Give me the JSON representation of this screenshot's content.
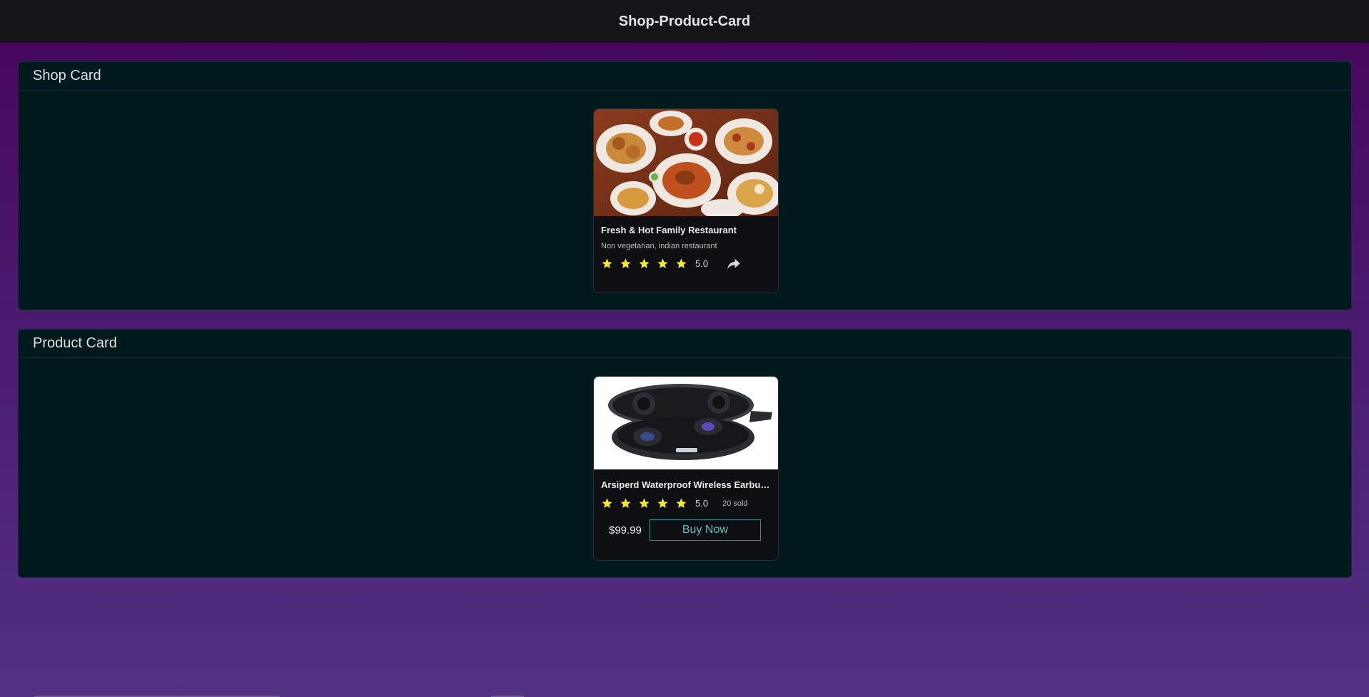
{
  "header": {
    "title": "Shop-Product-Card"
  },
  "shop_panel": {
    "title": "Shop Card",
    "card": {
      "image": "food-platter-image",
      "name": "Fresh & Hot Family Restaurant",
      "subtitle": "Non vegetarian, indian restaurant",
      "stars": 5,
      "rating": "5.0",
      "share_icon": "share-icon"
    }
  },
  "product_panel": {
    "title": "Product Card",
    "card": {
      "image": "earbuds-case-image",
      "name": "Arsiperd Waterproof Wireless Earbuds",
      "stars": 5,
      "rating": "5.0",
      "sold": "20 sold",
      "price": "$99.99",
      "buy_label": "Buy Now"
    }
  },
  "colors": {
    "star": "#f6e82a",
    "accent": "#66c0c2",
    "panel_bg": "#00191c",
    "topbar_bg": "#141517"
  }
}
